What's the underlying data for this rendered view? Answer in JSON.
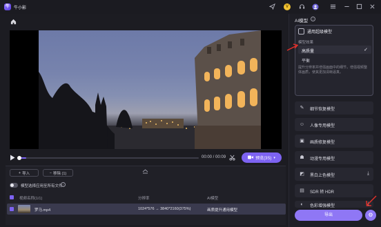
{
  "app": {
    "title": "牛小影",
    "logo_letter": "牛"
  },
  "titlebar": {
    "vip_label": "V"
  },
  "player": {
    "time": "00:00 / 00:09",
    "progress": 0.04,
    "preview_label": "预览(3S)"
  },
  "toolbar": {
    "import_label": "导入",
    "remove_label": "移除 (1)"
  },
  "options": {
    "apply_all_label": "模型选择应用至所有文件",
    "apply_all_on": false
  },
  "table": {
    "headers": [
      "视频名称(1/1)",
      "分辨率",
      "AI模型"
    ],
    "rows": [
      {
        "name": "罗马.mp4",
        "resolution": "1024*576 → 3840*2160(375%)",
        "model": "画质提升通用模型"
      }
    ]
  },
  "panel": {
    "title": "AI模型",
    "general_model": {
      "label": "通用超级模型",
      "effect_label": "模型效果",
      "options": [
        {
          "label": "高质量",
          "selected": true
        },
        {
          "label": "平衡",
          "selected": false
        }
      ],
      "description": "提升分辨率并增强画面中的细节，增强视频整体画质，使其更加清晰逼真。"
    },
    "models": [
      {
        "label": "细节恢复模型",
        "icon": "detail-icon",
        "download": false
      },
      {
        "label": "人像专用模型",
        "icon": "face-icon",
        "download": false
      },
      {
        "label": "画质修复模型",
        "icon": "repair-icon",
        "download": false
      },
      {
        "label": "动漫专用模型",
        "icon": "anime-icon",
        "download": false
      },
      {
        "label": "黑白上色模型",
        "icon": "colorize-icon",
        "download": true
      },
      {
        "label": "SDR 转 HDR",
        "icon": "hdr-icon",
        "download": false
      },
      {
        "label": "色彩增强模型",
        "icon": "palette-icon",
        "download": true
      }
    ],
    "export_label": "导出"
  },
  "colors": {
    "accent": "#7d63f2",
    "background": "#1c1c22",
    "annotation": "#e0302a"
  }
}
